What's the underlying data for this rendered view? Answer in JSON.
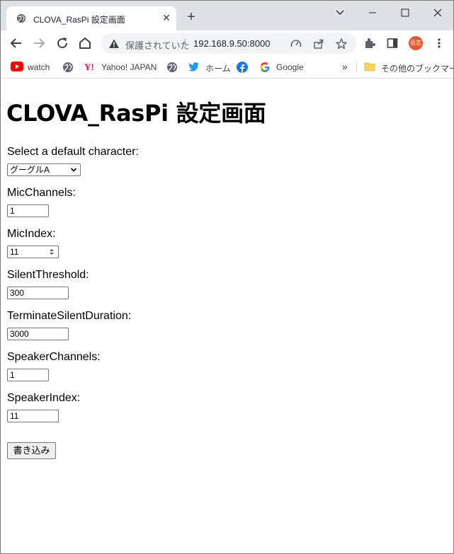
{
  "browser": {
    "tab_title": "CLOVA_RasPi 設定画面",
    "security_status": "保護されていた",
    "url": "192.168.9.50:8000",
    "profile_initials": "岳志"
  },
  "bookmarks": {
    "items": [
      {
        "label": "watch",
        "icon": "youtube-icon"
      },
      {
        "label": "",
        "icon": "globe-icon"
      },
      {
        "label": "Yahoo! JAPAN",
        "icon": "yahoo-icon"
      },
      {
        "label": "",
        "icon": "globe-icon"
      },
      {
        "label": "ホーム",
        "icon": "twitter-icon"
      },
      {
        "label": "",
        "icon": "facebook-icon"
      },
      {
        "label": "Google",
        "icon": "google-icon"
      }
    ],
    "overflow": "»",
    "other_folder": "その他のブックマーク"
  },
  "form": {
    "heading": "CLOVA_RasPi 設定画面",
    "character_label": "Select a default character:",
    "character_value": "グーグルA",
    "mic_channels_label": "MicChannels:",
    "mic_channels_value": "1",
    "mic_index_label": "MicIndex:",
    "mic_index_value": "11",
    "silent_threshold_label": "SilentThreshold:",
    "silent_threshold_value": "300",
    "terminate_silent_duration_label": "TerminateSilentDuration:",
    "terminate_silent_duration_value": "3000",
    "speaker_channels_label": "SpeakerChannels:",
    "speaker_channels_value": "1",
    "speaker_index_label": "SpeakerIndex:",
    "speaker_index_value": "11",
    "submit_label": "書き込み"
  }
}
